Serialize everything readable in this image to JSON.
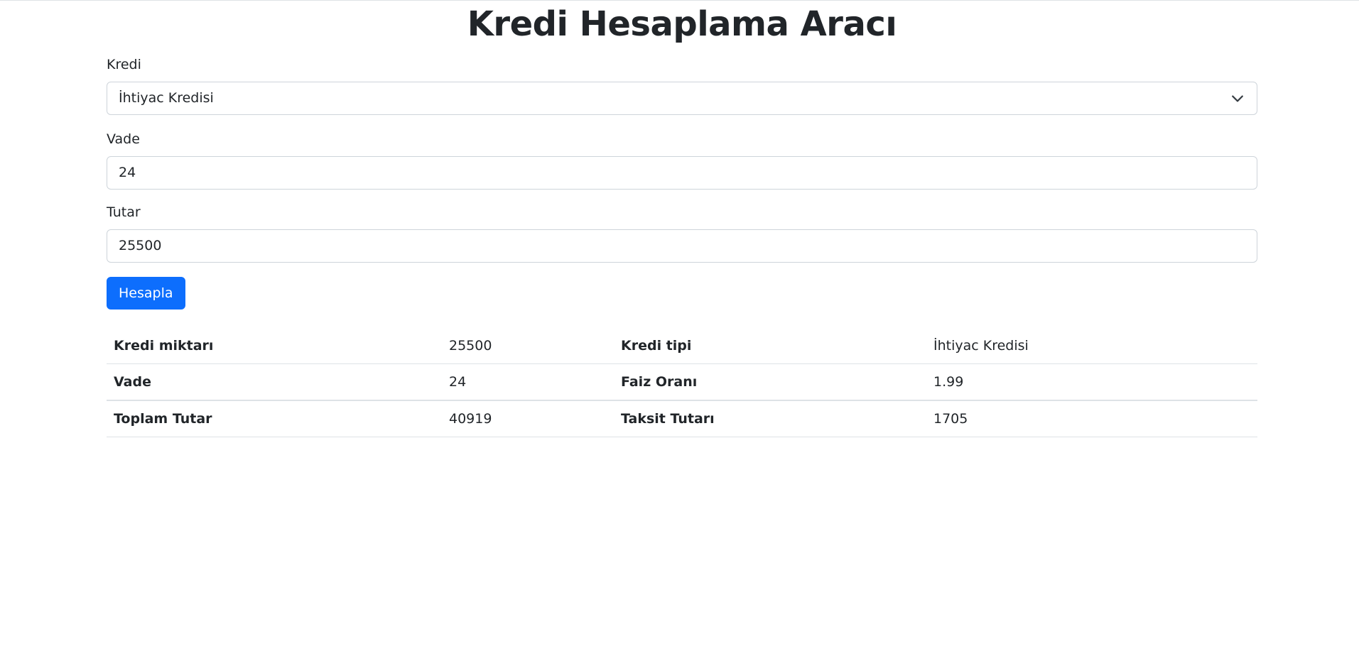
{
  "page": {
    "title": "Kredi Hesaplama Aracı"
  },
  "form": {
    "kredi": {
      "label": "Kredi",
      "selected": "İhtiyac Kredisi"
    },
    "vade": {
      "label": "Vade",
      "value": "24"
    },
    "tutar": {
      "label": "Tutar",
      "value": "25500"
    },
    "submit_label": "Hesapla"
  },
  "results": {
    "rows": [
      {
        "k1": "Kredi miktarı",
        "v1": "25500",
        "k2": "Kredi tipi",
        "v2": "İhtiyac Kredisi"
      },
      {
        "k1": "Vade",
        "v1": "24",
        "k2": "Faiz Oranı",
        "v2": "1.99"
      },
      {
        "k1": "Toplam Tutar",
        "v1": "40919",
        "k2": "Taksit Tutarı",
        "v2": "1705"
      }
    ]
  },
  "colors": {
    "primary": "#0d6efd",
    "text": "#212529",
    "border": "#ced4da"
  }
}
